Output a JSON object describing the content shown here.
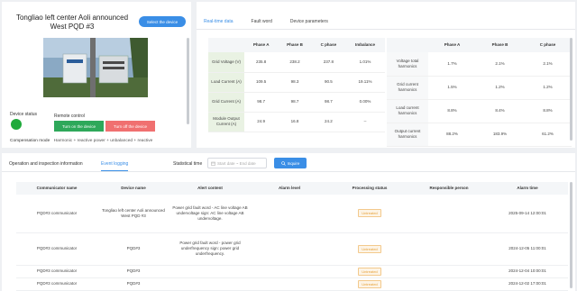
{
  "device": {
    "title": "Tongliao left center Aoli announced West PQD #3",
    "select_label": "Select the device",
    "status_label": "Device status",
    "status_color": "#1faa3b",
    "remote_control_label": "Remote control",
    "turn_on_label": "Turn on the device",
    "turn_off_label": "Turn off the device",
    "compensation_label": "Compensation mode",
    "compensation_value": "Harmonic + reactive power + unbalanced + reactive"
  },
  "realtime": {
    "tabs": [
      "Real-time data",
      "Fault word",
      "Device parameters"
    ],
    "measurements": {
      "headers": [
        "",
        "Phase A",
        "Phase B",
        "C phase",
        "Imbalance"
      ],
      "rows": [
        [
          "Grid Voltage (V)",
          "235.8",
          "238.2",
          "237.8",
          "1.01%"
        ],
        [
          "Load Current (A)",
          "109.5",
          "98.3",
          "90.5",
          "19.11%"
        ],
        [
          "Grid Current (A)",
          "98.7",
          "98.7",
          "98.7",
          "0.00%"
        ],
        [
          "Module Output Current (A)",
          "24.9",
          "16.8",
          "24.2",
          "--"
        ]
      ]
    },
    "harmonics": {
      "headers": [
        "",
        "Phase A",
        "Phase B",
        "C phase"
      ],
      "rows": [
        [
          "Voltage total harmonics",
          "1.7%",
          "2.1%",
          "2.1%"
        ],
        [
          "Grid current harmonics",
          "1.5%",
          "1.2%",
          "1.2%"
        ],
        [
          "Load current harmonics",
          "8.8%",
          "8.4%",
          "8.8%"
        ],
        [
          "Output current harmonics",
          "88.2%",
          "183.9%",
          "61.2%"
        ]
      ]
    }
  },
  "events": {
    "section_title": "Operation and inspection information",
    "tab_label": "Event logging",
    "stat_time_label": "Statistical time",
    "date_placeholder": "Start date ~ End date",
    "inquire_label": "Inquire",
    "headers": [
      "Communicator name",
      "Device name",
      "Alert content",
      "Alarm level",
      "Processing status",
      "Responsible person",
      "Alarm time"
    ],
    "rows": [
      [
        "PQD#3 communicator",
        "Tongliao left center Aoli announced West PQD #3",
        "Power grid fault word - AC line voltage AB undervoltage sign: AC line voltage AB undervoltage.",
        "",
        "Untreated",
        "",
        "2025-09-14 12:00:01"
      ],
      [
        "PQD#3 communicator",
        "PQD#3",
        "Power grid fault word - power grid underfrequency sign: power grid underfrequency.",
        "",
        "Untreated",
        "",
        "2024-12-05 11:00:01"
      ],
      [
        "PQD#3 communicator",
        "PQD#3",
        "",
        "",
        "Untreated",
        "",
        "2024-12-04 10:00:01"
      ],
      [
        "PQD#3 communicator",
        "PQD#3",
        "",
        "",
        "Untreated",
        "",
        "2024-12-02 17:00:01"
      ]
    ]
  }
}
